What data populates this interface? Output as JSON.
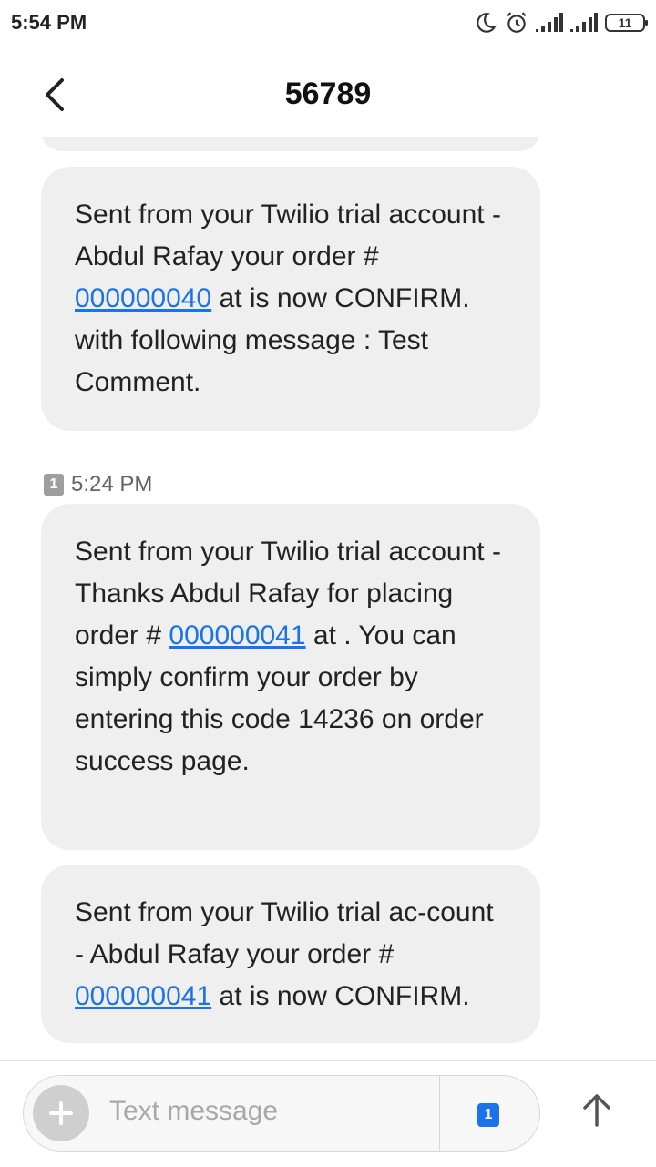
{
  "status_bar": {
    "time": "5:54 PM",
    "battery_level": "11",
    "icons": [
      "moon-icon",
      "alarm-icon",
      "signal-icon",
      "signal-icon",
      "battery-icon"
    ]
  },
  "header": {
    "title": "56789",
    "back_icon": "chevron-left-icon"
  },
  "messages": [
    {
      "text_before": "Sent from your Twilio trial account - Abdul Rafay your order # ",
      "link": "000000040",
      "text_after": " at  is now CONFIRM.  with following message : Test Comment."
    },
    {
      "timestamp": "5:24 PM",
      "sim": "1",
      "text_before": "Sent from your Twilio trial account - Thanks Abdul Rafay for placing order # ",
      "link": "000000041",
      "text_after": " at . You can simply confirm your order by entering this code 14236 on order success page."
    },
    {
      "text_before": "Sent from your Twilio trial ac-count - Abdul Rafay your order # ",
      "link": "000000041",
      "text_after": " at  is now CONFIRM."
    }
  ],
  "composer": {
    "placeholder": "Text message",
    "sim_label": "1",
    "send_icon": "arrow-up-icon",
    "attach_icon": "plus-icon"
  },
  "colors": {
    "bubble": "#efefef",
    "link": "#1a73e8",
    "sim_active": "#1a73e8"
  }
}
